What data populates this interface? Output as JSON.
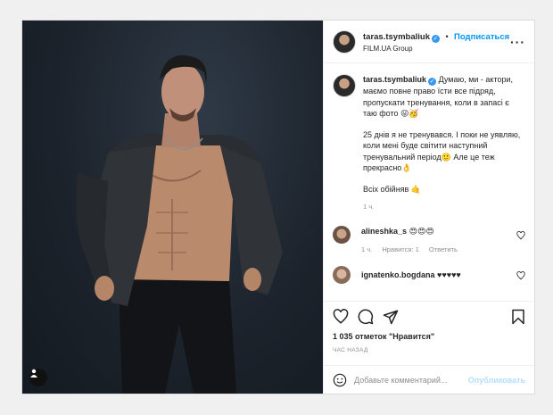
{
  "post": {
    "author": {
      "username": "taras.tsymbaliuk",
      "follow_label": "Подписаться",
      "location": "FILM.UA Group",
      "separator": "•"
    },
    "caption": {
      "username": "taras.tsymbaliuk",
      "line1": "Думаю, ми - актори, маємо повне право їсти все підряд, пропускати тренування, коли в запасі є таю фото 😜🥳",
      "line2": "25 днів я не тренувався. І поки не уявляю, коли мені буде світити наступний тренувальний період🙂 Але це теж прекрасно👌",
      "line3": "Всіх обійняв 🤙",
      "time": "1 ч."
    },
    "comments": [
      {
        "username": "alineshka_s",
        "text": "😍😍😍",
        "time": "1 ч.",
        "likes": "Нравится: 1",
        "reply": "Ответить"
      },
      {
        "username": "ignatenko.bogdana",
        "text": "♥♥♥♥♥"
      }
    ],
    "likes_text": "1 035 отметок \"Нравится\"",
    "posted_ago": "ЧАС НАЗАД",
    "comment_placeholder": "Добавьте комментарий...",
    "publish_label": "Опубликовать",
    "icons": [
      "heart-icon",
      "comment-icon",
      "share-icon",
      "bookmark-icon",
      "more-icon",
      "user-tag-icon",
      "verified-icon"
    ]
  }
}
